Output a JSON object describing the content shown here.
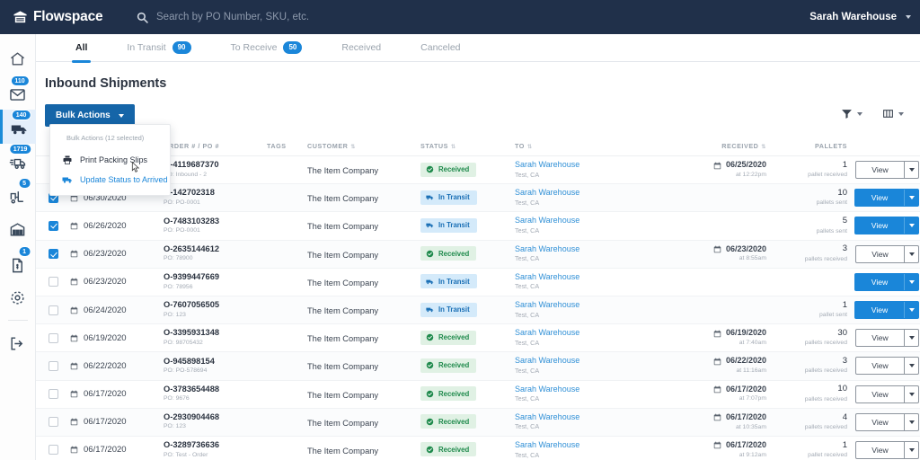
{
  "topbar": {
    "logo_text": "Flowspace",
    "logo_icon": "warehouse-icon",
    "search_icon": "search-icon",
    "search_placeholder": "Search by PO Number, SKU, etc.",
    "search_value": "",
    "user_name": "Sarah Warehouse",
    "user_caret_icon": "chevron-down-icon"
  },
  "sidebar": {
    "items": [
      {
        "name": "home",
        "icon": "home-icon",
        "badge": "",
        "active": false
      },
      {
        "name": "messages",
        "icon": "mail-icon",
        "badge": "110",
        "active": false
      },
      {
        "name": "inbound",
        "icon": "truck-icon",
        "badge": "140",
        "active": true
      },
      {
        "name": "outbound",
        "icon": "delivery-icon",
        "badge": "1719",
        "active": false
      },
      {
        "name": "inventory",
        "icon": "forklift-icon",
        "badge": "5",
        "active": false
      },
      {
        "name": "warehouse",
        "icon": "building-icon",
        "badge": "",
        "active": false
      },
      {
        "name": "billing",
        "icon": "invoice-icon",
        "badge": "1",
        "active": false
      },
      {
        "name": "settings",
        "icon": "gear-icon",
        "badge": "",
        "active": false
      },
      {
        "name": "logout",
        "icon": "logout-icon",
        "badge": "",
        "active": false
      }
    ]
  },
  "tabs": [
    {
      "label": "All",
      "badge": "",
      "active": true
    },
    {
      "label": "In Transit",
      "badge": "90",
      "active": false
    },
    {
      "label": "To Receive",
      "badge": "50",
      "active": false
    },
    {
      "label": "Received",
      "badge": "",
      "active": false
    },
    {
      "label": "Canceled",
      "badge": "",
      "active": false
    }
  ],
  "page": {
    "title": "Inbound Shipments",
    "bulk_button": "Bulk Actions",
    "filter_icon": "filter-icon",
    "columns_icon": "columns-icon"
  },
  "dropdown": {
    "header": "Bulk Actions (12 selected)",
    "items": [
      {
        "label": "Print Packing Slips",
        "icon": "printer-icon",
        "link": false
      },
      {
        "label": "Update Status to Arrived",
        "icon": "truck-icon",
        "link": true
      }
    ],
    "cursor_icon": "cursor-pointer-icon"
  },
  "table": {
    "headers": [
      "ORDER #  /  PO #",
      "TAGS",
      "CUSTOMER",
      "STATUS",
      "TO",
      "RECEIVED",
      "PALLETS"
    ],
    "view_label": "View",
    "rows": [
      {
        "checked": false,
        "date": "",
        "order": "O-4119687370",
        "po": "PO: Inbound - 2",
        "customer": "The Item Company",
        "status": "Received",
        "status_type": "received",
        "to": "Sarah Warehouse",
        "to_sub": "Test, CA",
        "received_date": "06/25/2020",
        "received_time": "at 12:22pm",
        "pallets": "1",
        "pallets_sub": "pallet received",
        "btn": "light"
      },
      {
        "checked": true,
        "date": "06/30/2020",
        "order": "O-142702318",
        "po": "PO: PO-0001",
        "customer": "The Item Company",
        "status": "In Transit",
        "status_type": "transit",
        "to": "Sarah Warehouse",
        "to_sub": "Test, CA",
        "received_date": "",
        "received_time": "",
        "pallets": "10",
        "pallets_sub": "pallets sent",
        "btn": "blue"
      },
      {
        "checked": true,
        "date": "06/26/2020",
        "order": "O-7483103283",
        "po": "PO: PO-0001",
        "customer": "The Item Company",
        "status": "In Transit",
        "status_type": "transit",
        "to": "Sarah Warehouse",
        "to_sub": "Test, CA",
        "received_date": "",
        "received_time": "",
        "pallets": "5",
        "pallets_sub": "pallets sent",
        "btn": "blue"
      },
      {
        "checked": true,
        "date": "06/23/2020",
        "order": "O-2635144612",
        "po": "PO: 78900",
        "customer": "The Item Company",
        "status": "Received",
        "status_type": "received",
        "to": "Sarah Warehouse",
        "to_sub": "Test, CA",
        "received_date": "06/23/2020",
        "received_time": "at 8:55am",
        "pallets": "3",
        "pallets_sub": "pallets received",
        "btn": "light"
      },
      {
        "checked": false,
        "date": "06/23/2020",
        "order": "O-9399447669",
        "po": "PO: 78956",
        "customer": "The Item Company",
        "status": "In Transit",
        "status_type": "transit",
        "to": "Sarah Warehouse",
        "to_sub": "Test, CA",
        "received_date": "",
        "received_time": "",
        "pallets": "",
        "pallets_sub": "",
        "btn": "blue"
      },
      {
        "checked": false,
        "date": "06/24/2020",
        "order": "O-7607056505",
        "po": "PO: 123",
        "customer": "The Item Company",
        "status": "In Transit",
        "status_type": "transit",
        "to": "Sarah Warehouse",
        "to_sub": "Test, CA",
        "received_date": "",
        "received_time": "",
        "pallets": "1",
        "pallets_sub": "pallet sent",
        "btn": "blue"
      },
      {
        "checked": false,
        "date": "06/19/2020",
        "order": "O-3395931348",
        "po": "PO: 98705432",
        "customer": "The Item Company",
        "status": "Received",
        "status_type": "received",
        "to": "Sarah Warehouse",
        "to_sub": "Test, CA",
        "received_date": "06/19/2020",
        "received_time": "at 7:40am",
        "pallets": "30",
        "pallets_sub": "pallets received",
        "btn": "light"
      },
      {
        "checked": false,
        "date": "06/22/2020",
        "order": "O-945898154",
        "po": "PO: PO-578694",
        "customer": "The Item Company",
        "status": "Received",
        "status_type": "received",
        "to": "Sarah Warehouse",
        "to_sub": "Test, CA",
        "received_date": "06/22/2020",
        "received_time": "at 11:16am",
        "pallets": "3",
        "pallets_sub": "pallets received",
        "btn": "light"
      },
      {
        "checked": false,
        "date": "06/17/2020",
        "order": "O-3783654488",
        "po": "PO: 9676",
        "customer": "The Item Company",
        "status": "Received",
        "status_type": "received",
        "to": "Sarah Warehouse",
        "to_sub": "Test, CA",
        "received_date": "06/17/2020",
        "received_time": "at 7:07pm",
        "pallets": "10",
        "pallets_sub": "pallets received",
        "btn": "light"
      },
      {
        "checked": false,
        "date": "06/17/2020",
        "order": "O-2930904468",
        "po": "PO: 123",
        "customer": "The Item Company",
        "status": "Received",
        "status_type": "received",
        "to": "Sarah Warehouse",
        "to_sub": "Test, CA",
        "received_date": "06/17/2020",
        "received_time": "at 10:35am",
        "pallets": "4",
        "pallets_sub": "pallets received",
        "btn": "light"
      },
      {
        "checked": false,
        "date": "06/17/2020",
        "order": "O-3289736636",
        "po": "PO: Test - Order",
        "customer": "The Item Company",
        "status": "Received",
        "status_type": "received",
        "to": "Sarah Warehouse",
        "to_sub": "Test, CA",
        "received_date": "06/17/2020",
        "received_time": "at 9:12am",
        "pallets": "1",
        "pallets_sub": "pallet received",
        "btn": "light"
      }
    ]
  },
  "colors": {
    "topbar": "#20304a",
    "accent": "#1a86d9",
    "bulk_button": "#1565a8",
    "received_bg": "#e0f1e4",
    "received_fg": "#1f8a4c",
    "transit_bg": "#d4eafa",
    "transit_fg": "#1a6fb5"
  }
}
